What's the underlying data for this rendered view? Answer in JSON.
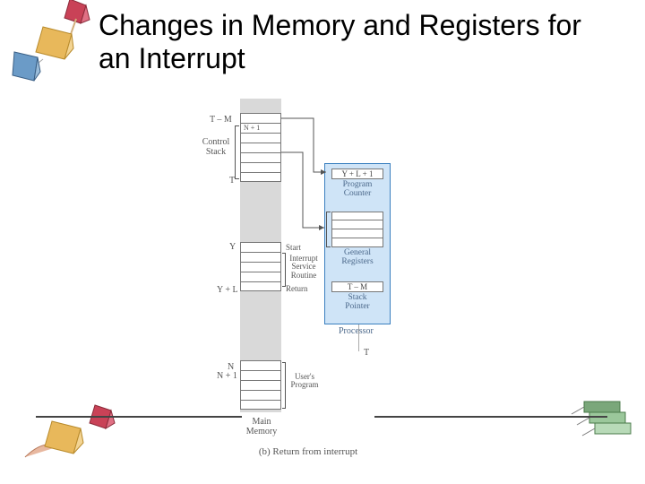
{
  "title": "Changes in Memory and Registers for an Interrupt",
  "memory": {
    "topAddr1": "T – M",
    "topSlot": "N + 1",
    "controlStack": "Control\nStack",
    "tLabel": "T",
    "yLabel": "Y",
    "start": "Start",
    "isr": "Interrupt\nService\nRoutine",
    "yLLabel": "Y + L",
    "ret": "Return",
    "nLabel": "N",
    "n1Label": "N + 1",
    "userProg": "User's\nProgram",
    "main": "Main\nMemory"
  },
  "processor": {
    "title": "Processor",
    "pcVal": "Y + L + 1",
    "pcLbl": "Program\nCounter",
    "grLbl": "General\nRegisters",
    "spVal": "T – M",
    "spLbl": "Stack\nPointer",
    "tOut": "T"
  },
  "caption": "(b) Return from interrupt"
}
